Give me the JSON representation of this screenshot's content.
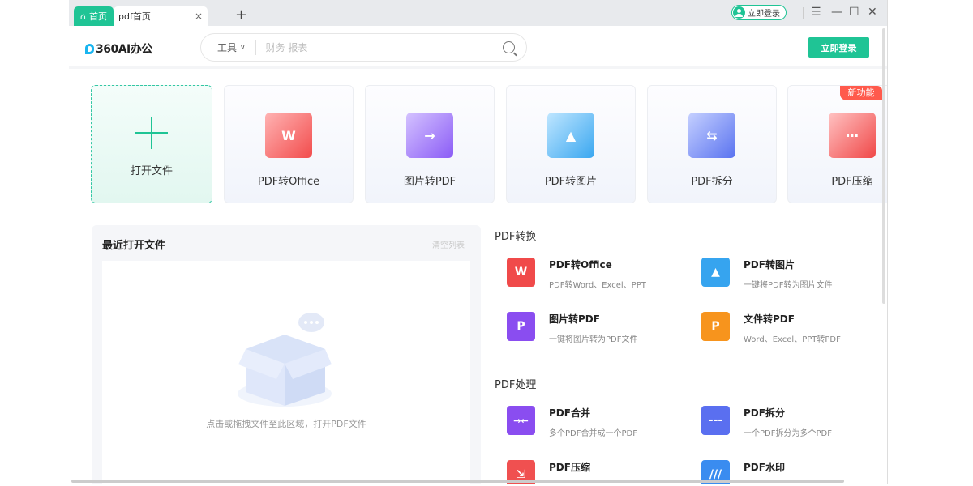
{
  "tabs": {
    "home_label": "首页",
    "active_label": "pdf首页",
    "close": "×",
    "add": "+"
  },
  "titlebar": {
    "login_label": "立即登录",
    "menu": "☰",
    "minimize": "—",
    "maximize": "☐",
    "close": "✕"
  },
  "header": {
    "logo_text": "360AI办公",
    "tool_label": "工具",
    "search_placeholder": "财务 报表",
    "login_button": "立即登录"
  },
  "cards": [
    {
      "label": "打开文件"
    },
    {
      "label": "PDF转Office",
      "color": "#f24c4c"
    },
    {
      "label": "图片转PDF",
      "color": "#8b5cf6"
    },
    {
      "label": "PDF转图片",
      "color": "#3aa7f0"
    },
    {
      "label": "PDF拆分",
      "color": "#5a73f0"
    },
    {
      "label": "PDF压缩",
      "color": "#f04848",
      "badge": "新功能"
    }
  ],
  "recent": {
    "title": "最近打开文件",
    "clear_label": "清空列表",
    "empty_text": "点击或拖拽文件至此区域，打开PDF文件"
  },
  "sections": [
    {
      "title": "PDF转换",
      "items": [
        {
          "title": "PDF转Office",
          "desc": "PDF转Word、Excel、PPT",
          "glyph": "W",
          "color": "#f04a4a"
        },
        {
          "title": "PDF转图片",
          "desc": "一键将PDF转为图片文件",
          "glyph": "▲",
          "color": "#36a4ef"
        },
        {
          "title": "图片转PDF",
          "desc": "一键将图片转为PDF文件",
          "glyph": "P",
          "color": "#8a4df0"
        },
        {
          "title": "文件转PDF",
          "desc": "Word、Excel、PPT转PDF",
          "glyph": "P",
          "color": "#f7941d"
        }
      ]
    },
    {
      "title": "PDF处理",
      "items": [
        {
          "title": "PDF合并",
          "desc": "多个PDF合并成一个PDF",
          "glyph": "→←",
          "color": "#8a4df0"
        },
        {
          "title": "PDF拆分",
          "desc": "一个PDF拆分为多个PDF",
          "glyph": "---",
          "color": "#5a6ff0"
        },
        {
          "title": "PDF压缩",
          "desc": "",
          "glyph": "⇲",
          "color": "#f05050"
        },
        {
          "title": "PDF水印",
          "desc": "",
          "glyph": "///",
          "color": "#3a8cf0"
        }
      ]
    }
  ]
}
